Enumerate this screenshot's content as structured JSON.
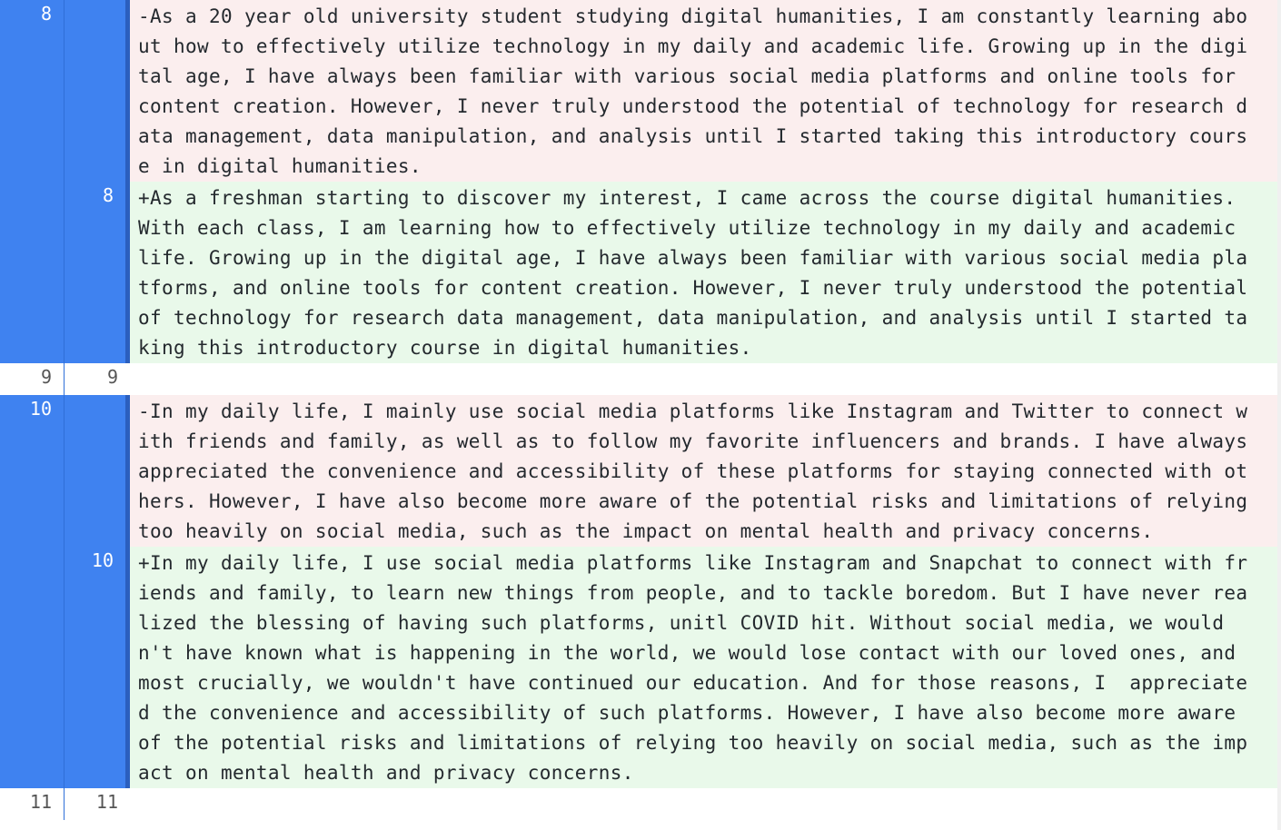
{
  "colors": {
    "gutter_changed": "#3f82f0",
    "deleted_bg": "#fbeeee",
    "added_bg": "#e9f9ea"
  },
  "hunks": [
    {
      "type": "del",
      "old_no": "8",
      "new_no": "",
      "lines": [
        "-As a 20 year old university student studying digital humanities, I am constantly learning abo",
        "ut how to effectively utilize technology in my daily and academic life. Growing up in the digi",
        "tal age, I have always been familiar with various social media platforms and online tools for",
        "content creation. However, I never truly understood the potential of technology for research d",
        "ata management, data manipulation, and analysis until I started taking this introductory cours",
        "e in digital humanities."
      ]
    },
    {
      "type": "add",
      "old_no": "",
      "new_no": "8",
      "lines": [
        "+As a freshman starting to discover my interest, I came across the course digital humanities.",
        "With each class, I am learning how to effectively utilize technology in my daily and academic",
        "life. Growing up in the digital age, I have always been familiar with various social media pla",
        "tforms, and online tools for content creation. However, I never truly understood the potential",
        "of technology for research data management, data manipulation, and analysis until I started ta",
        "king this introductory course in digital humanities."
      ]
    },
    {
      "type": "ctx",
      "old_no": "9",
      "new_no": "9",
      "lines": [
        ""
      ]
    },
    {
      "type": "del",
      "old_no": "10",
      "new_no": "",
      "lines": [
        "-In my daily life, I mainly use social media platforms like Instagram and Twitter to connect w",
        "ith friends and family, as well as to follow my favorite influencers and brands. I have always",
        "appreciated the convenience and accessibility of these platforms for staying connected with ot",
        "hers. However, I have also become more aware of the potential risks and limitations of relying",
        "too heavily on social media, such as the impact on mental health and privacy concerns."
      ]
    },
    {
      "type": "add",
      "old_no": "",
      "new_no": "10",
      "lines": [
        "+In my daily life, I use social media platforms like Instagram and Snapchat to connect with fr",
        "iends and family, to learn new things from people, and to tackle boredom. But I have never rea",
        "lized the blessing of having such platforms, unitl COVID hit. Without social media, we would",
        "n't have known what is happening in the world, we would lose contact with our loved ones, and",
        "most crucially, we wouldn't have continued our education. And for those reasons, I  appreciate",
        "d the convenience and accessibility of such platforms. However, I have also become more aware",
        "of the potential risks and limitations of relying too heavily on social media, such as the imp",
        "act on mental health and privacy concerns."
      ]
    },
    {
      "type": "ctx",
      "old_no": "11",
      "new_no": "11",
      "lines": [
        ""
      ]
    }
  ]
}
